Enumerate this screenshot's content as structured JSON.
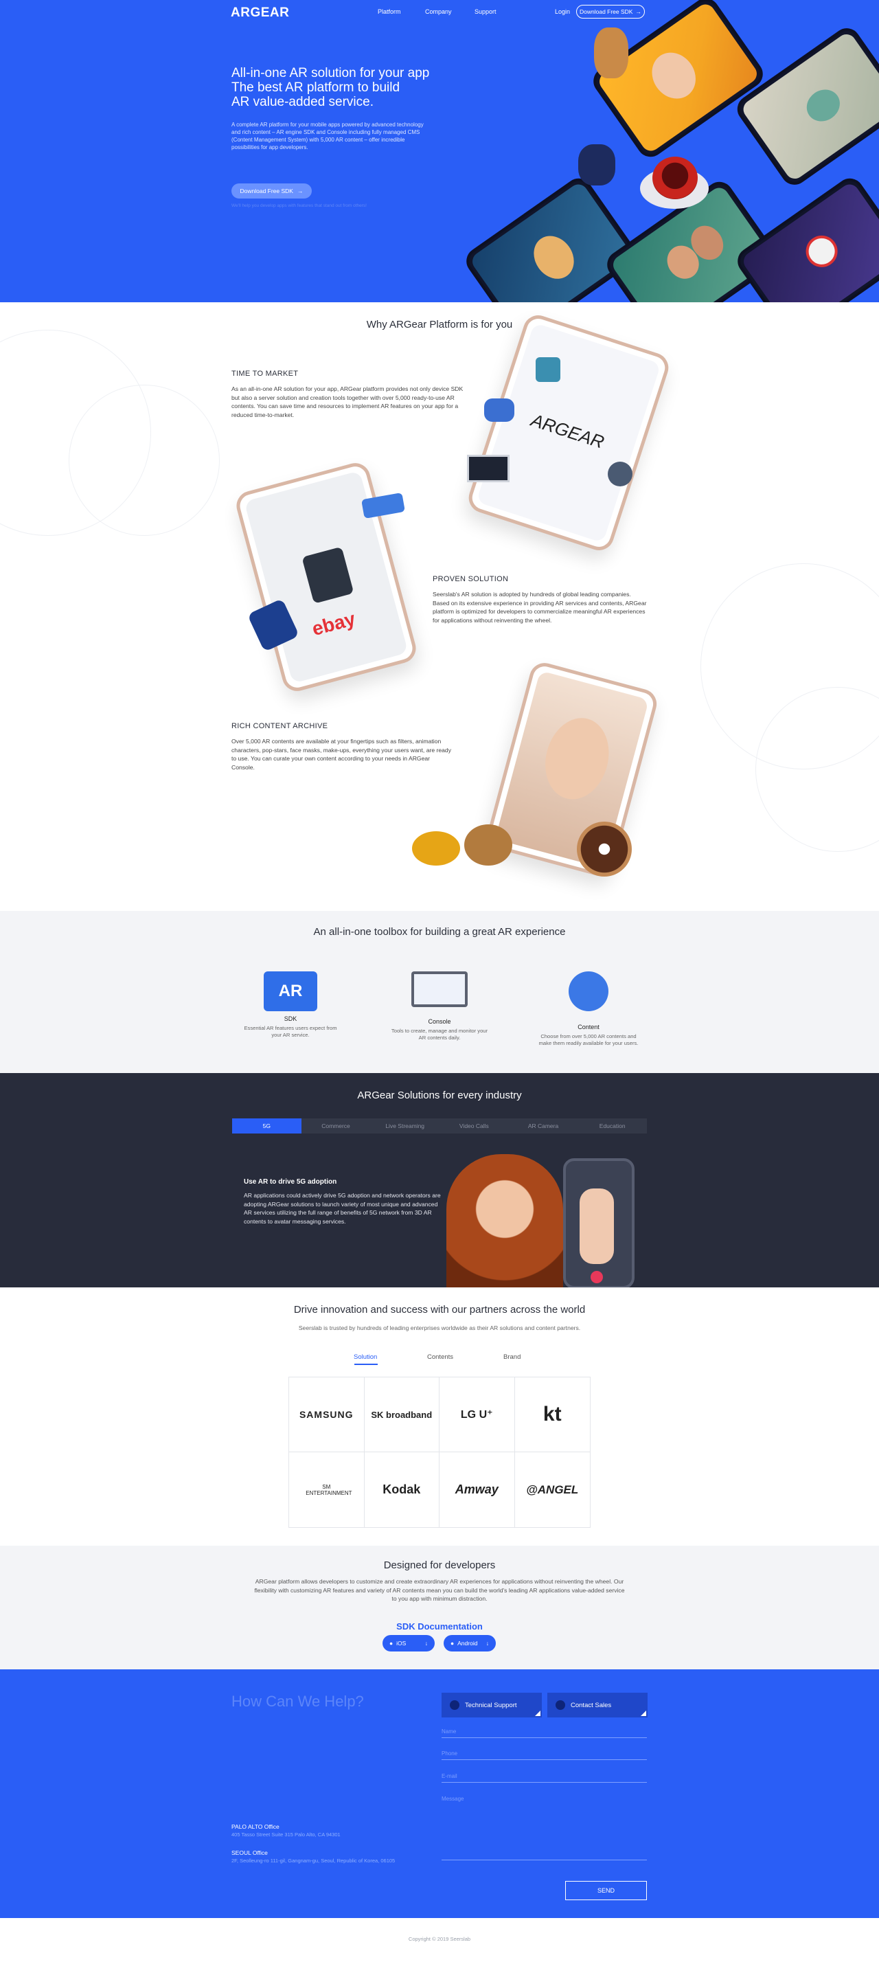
{
  "nav": {
    "logo": "ARGEAR",
    "links": [
      "Platform",
      "Company",
      "Support"
    ],
    "login": "Login",
    "download": "Download Free SDK"
  },
  "hero": {
    "title_lines": [
      "All-in-one AR solution for your app",
      "The best AR platform to build",
      "AR value-added service."
    ],
    "description": "A complete AR platform for your mobile apps powered by advanced technology and rich content – AR engine SDK and Console including fully managed CMS (Content Management System) with 5,000 AR content – offer incredible possibilities for app developers.",
    "button": "Download Free SDK",
    "note": "We'll help you develop apps with features that stand out from others!"
  },
  "why": {
    "title": "Why ARGear Platform is for you",
    "features": [
      {
        "title": "TIME TO MARKET",
        "text": "As an all-in-one AR solution for your app, ARGear platform provides not only device SDK but also a server solution and creation tools together with over 5,000 ready-to-use AR contents. You can save time and resources to implement AR features on your app for a reduced time-to-market."
      },
      {
        "title": "PROVEN SOLUTION",
        "text": "Seerslab's AR solution is adopted by hundreds of global leading companies. Based on its extensive experience in providing AR services and contents, ARGear platform is optimized for developers to commercialize meaningful AR experiences for applications without reinventing the wheel."
      },
      {
        "title": "RICH CONTENT ARCHIVE",
        "text": "Over 5,000 AR contents are available at your fingertips such as filters, animation characters, pop-stars, face masks, make-ups, everything your users want, are ready to use. You can curate your own content according to your needs in ARGear Console."
      }
    ],
    "phone_logo": "ARGEAR",
    "ebay": "ebay"
  },
  "toolbox": {
    "title": "An all-in-one toolbox for building a great AR experience",
    "items": [
      {
        "name": "SDK",
        "desc": "Essential AR features users expect from your AR service.",
        "icon": "AR"
      },
      {
        "name": "Console",
        "desc": "Tools to create, manage and monitor your AR contents daily.",
        "icon": ""
      },
      {
        "name": "Content",
        "desc": "Choose from over 5,000 AR contents and make them readily available for your users.",
        "icon": ""
      }
    ]
  },
  "industry": {
    "title": "ARGear Solutions for every industry",
    "tabs": [
      "5G",
      "Commerce",
      "Live Streaming",
      "Video Calls",
      "AR Camera",
      "Education"
    ],
    "active_tab": 0,
    "heading": "Use AR to drive 5G adoption",
    "text": "AR applications could actively drive 5G adoption and network operators are adopting ARGear solutions to launch variety of most unique and advanced AR services utilizing the full range of benefits of 5G network from 3D AR contents to avatar messaging services."
  },
  "partners": {
    "title": "Drive innovation and success with our partners across the world",
    "subtitle": "Seerslab is trusted by hundreds of leading enterprises worldwide as their AR solutions and content partners.",
    "tabs": [
      "Solution",
      "Contents",
      "Brand"
    ],
    "logos": [
      "SAMSUNG",
      "SK broadband",
      "LG U⁺",
      "kt",
      "SM ENTERTAINMENT",
      "Kodak",
      "Amway",
      "@ANGEL"
    ]
  },
  "developers": {
    "title": "Designed for developers",
    "text": "ARGear platform allows developers to customize and create extraordinary AR experiences for applications without reinventing the wheel. Our flexibility with customizing AR features and variety of AR contents mean you can build the world's leading AR applications value-added service to you app with minimum distraction.",
    "sdk_doc": "SDK Documentation",
    "buttons": [
      "iOS",
      "Android"
    ]
  },
  "contact": {
    "title": "How Can We Help?",
    "tabs": [
      "Technical Support",
      "Contact Sales"
    ],
    "fields": [
      "Name",
      "Phone",
      "E-mail",
      "Message"
    ],
    "offices": [
      {
        "name": "PALO ALTO Office",
        "address": "405 Tasso Street Suite 315 Palo Alto, CA 94301"
      },
      {
        "name": "SEOUL Office",
        "address": "2F, Seolleung-ro 111-gil, Gangnam-gu, Seoul, Republic of Korea, 06105"
      }
    ],
    "send": "SEND"
  },
  "footer": {
    "copyright": "Copyright © 2019 Seerslab"
  },
  "colors": {
    "brand_blue": "#2a5ef6",
    "dark_navy": "#282c3b",
    "light_gray": "#f3f4f7"
  }
}
